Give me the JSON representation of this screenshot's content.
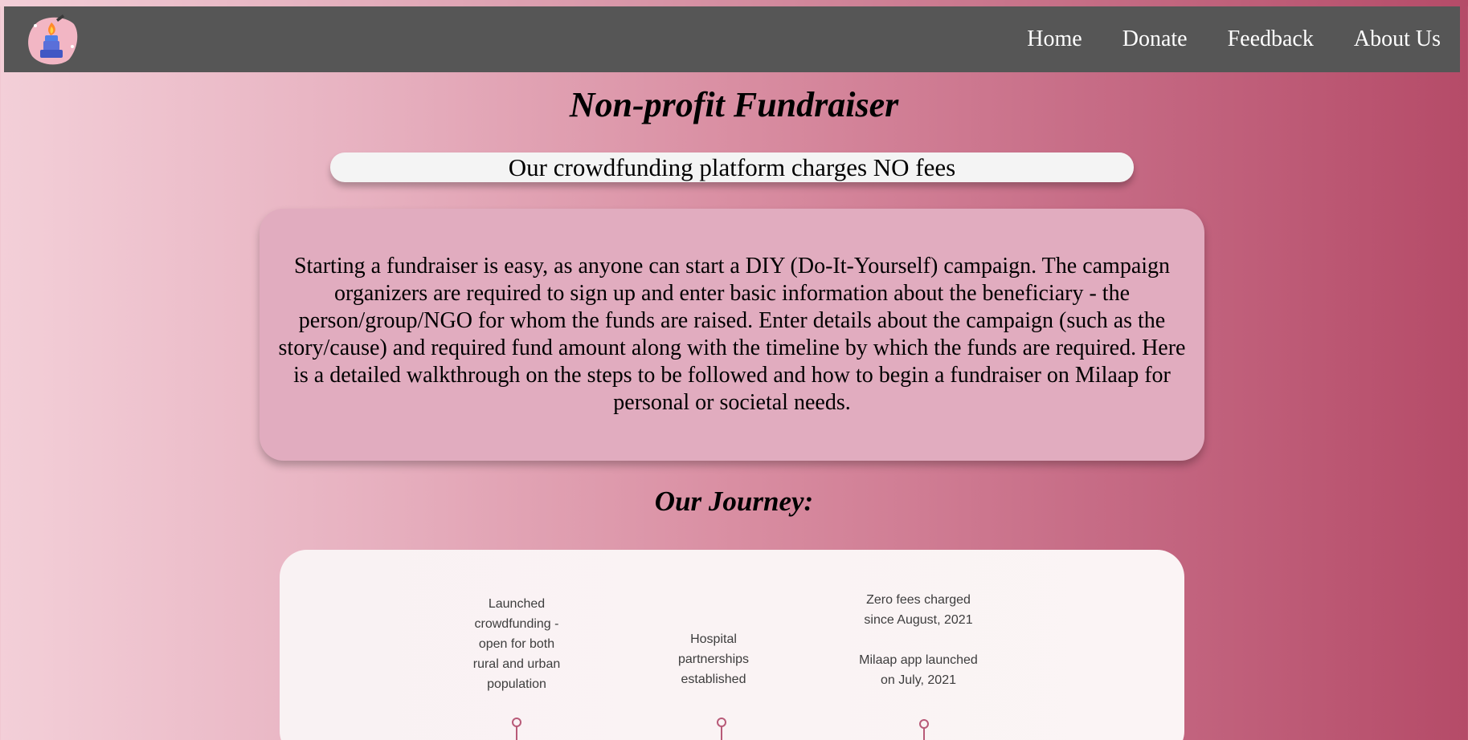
{
  "nav": {
    "logo_icon": "candle-icon",
    "links": [
      "Home",
      "Donate",
      "Feedback",
      "About Us"
    ]
  },
  "page": {
    "title": "Non-profit Fundraiser",
    "banner": "Our crowdfunding platform charges NO fees",
    "description": "Starting a fundraiser is easy, as anyone can start a DIY (Do-It-Yourself) campaign. The campaign organizers are required to sign up and enter basic information about the beneficiary - the person/group/NGO for whom the funds are raised. Enter details about the campaign (such as the story/cause) and required fund amount along with the timeline by which the funds are required. Here is a detailed walkthrough on the steps to be followed and how to begin a fundraiser on Milaap for personal or societal needs."
  },
  "journey": {
    "title": "Our Journey:",
    "milestones": [
      {
        "text": "Launched\ncrowdfunding -\nopen for both\nrural and urban\npopulation"
      },
      {
        "text": "Hospital\npartnerships\nestablished"
      },
      {
        "text": "Zero fees charged\nsince August, 2021\n\nMilaap app launched\non July, 2021"
      }
    ]
  },
  "colors": {
    "navbar": "#565656",
    "pin": "#b85a78",
    "card": "#e1acbf"
  }
}
